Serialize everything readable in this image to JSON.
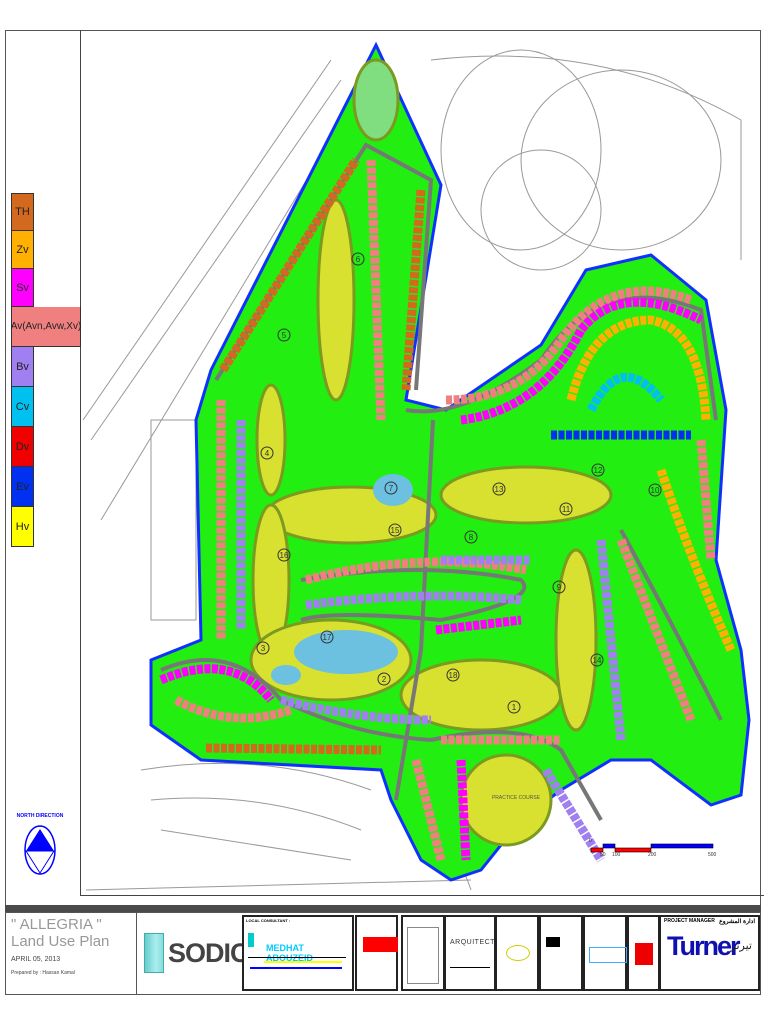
{
  "legend": [
    {
      "code": "TH",
      "color": "#d2691e"
    },
    {
      "code": "Zv",
      "color": "#ffb000"
    },
    {
      "code": "Sv",
      "color": "#ff00ff"
    },
    {
      "code": "Av(Avn,Avw,Xv)",
      "color": "#f08080"
    },
    {
      "code": "Bv",
      "color": "#a080f0"
    },
    {
      "code": "Cv",
      "color": "#00c0f0"
    },
    {
      "code": "Dv",
      "color": "#f00000"
    },
    {
      "code": "Ev",
      "color": "#0030f0"
    },
    {
      "code": "Hv",
      "color": "#ffff00"
    }
  ],
  "north": {
    "label": "NORTH DIRECTION"
  },
  "map": {
    "holes": [
      "1",
      "2",
      "3",
      "4",
      "5",
      "6",
      "7",
      "8",
      "9",
      "10",
      "11",
      "12",
      "13",
      "14",
      "15",
      "16",
      "17",
      "18"
    ],
    "practice_course": "PRACTICE COURSE",
    "scale_labels": [
      "0",
      "50",
      "100",
      "200",
      "500"
    ]
  },
  "title_block": {
    "project": "\" ALLEGRIA \"",
    "plan": "Land Use Plan",
    "date": "APRIL 05, 2013",
    "prepared_by": "Prepared by : Hassan Kamal",
    "developer": "SODIC",
    "local_consultant_label": "LOCAL CONSULTANT :",
    "local_consultant": "MEDHAT ABOUZEID",
    "architect": "ARQUITECTONICA",
    "project_manager_label": "PROJECT MANAGER",
    "project_manager_ar_label": "ادارة المشروع",
    "project_manager": "Turner",
    "project_manager_ar": "تيرنر"
  }
}
